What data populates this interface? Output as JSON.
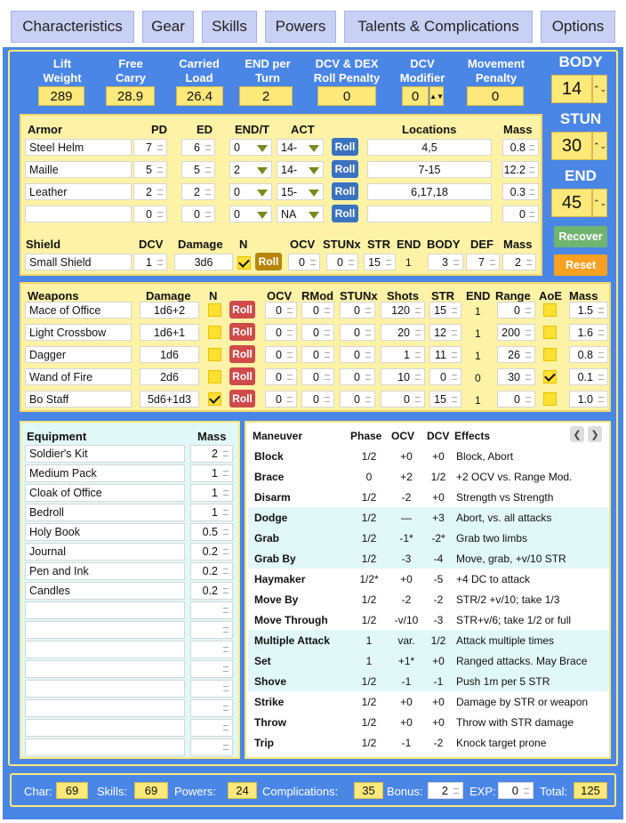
{
  "tabs": [
    "Characteristics",
    "Gear",
    "Skills",
    "Powers",
    "Talents & Complications",
    "Options"
  ],
  "stats": [
    {
      "label": "Lift Weight",
      "value": "289"
    },
    {
      "label": "Free Carry",
      "value": "28.9"
    },
    {
      "label": "Carried Load",
      "value": "26.4"
    },
    {
      "label": "END per Turn",
      "value": "2"
    },
    {
      "label": "DCV & DEX Roll Penalty",
      "value": "0"
    },
    {
      "label": "DCV Modifier",
      "value": "0"
    },
    {
      "label": "Movement Penalty",
      "value": "0"
    }
  ],
  "side": {
    "body_label": "BODY",
    "body": "14",
    "stun_label": "STUN",
    "stun": "30",
    "end_label": "END",
    "end": "45",
    "recover": "Recover",
    "reset": "Reset"
  },
  "armor": {
    "headers": [
      "Armor",
      "PD",
      "ED",
      "END/T",
      "ACT",
      "Locations",
      "Mass"
    ],
    "roll": "Roll",
    "rows": [
      {
        "name": "Steel Helm",
        "pd": "7",
        "ed": "6",
        "end": "0",
        "act": "14-",
        "loc": "4,5",
        "mass": "0.8"
      },
      {
        "name": "Maille",
        "pd": "5",
        "ed": "5",
        "end": "2",
        "act": "14-",
        "loc": "7-15",
        "mass": "12.2"
      },
      {
        "name": "Leather",
        "pd": "2",
        "ed": "2",
        "end": "0",
        "act": "15-",
        "loc": "6,17,18",
        "mass": "0.3"
      },
      {
        "name": "",
        "pd": "0",
        "ed": "0",
        "end": "0",
        "act": "NA",
        "loc": "",
        "mass": "0"
      }
    ]
  },
  "shield": {
    "headers": [
      "Shield",
      "DCV",
      "Damage",
      "N",
      "OCV",
      "STUNx",
      "STR",
      "END",
      "BODY",
      "DEF",
      "Mass"
    ],
    "name": "Small Shield",
    "dcv": "1",
    "damage": "3d6",
    "ocv": "0",
    "stunx": "0",
    "str": "15",
    "end": "1",
    "body": "3",
    "def": "7",
    "mass": "2",
    "roll": "Roll"
  },
  "weapons": {
    "headers": [
      "Weapons",
      "Damage",
      "N",
      "OCV",
      "RMod",
      "STUNx",
      "Shots",
      "STR",
      "END",
      "Range",
      "AoE",
      "Mass"
    ],
    "roll": "Roll",
    "rows": [
      {
        "name": "Mace of Office",
        "damage": "1d6+2",
        "n": false,
        "ocv": "0",
        "rmod": "0",
        "stunx": "0",
        "shots": "120",
        "str": "15",
        "end": "1",
        "range": "0",
        "aoe": false,
        "mass": "1.5"
      },
      {
        "name": "Light Crossbow",
        "damage": "1d6+1",
        "n": false,
        "ocv": "0",
        "rmod": "0",
        "stunx": "0",
        "shots": "20",
        "str": "12",
        "end": "1",
        "range": "200",
        "aoe": false,
        "mass": "1.6"
      },
      {
        "name": "Dagger",
        "damage": "1d6",
        "n": false,
        "ocv": "0",
        "rmod": "0",
        "stunx": "0",
        "shots": "1",
        "str": "11",
        "end": "1",
        "range": "26",
        "aoe": false,
        "mass": "0.8"
      },
      {
        "name": "Wand of Fire",
        "damage": "2d6",
        "n": false,
        "ocv": "0",
        "rmod": "0",
        "stunx": "0",
        "shots": "10",
        "str": "0",
        "end": "0",
        "range": "30",
        "aoe": true,
        "mass": "0.1"
      },
      {
        "name": "Bo Staff",
        "damage": "5d6+1d3",
        "n": true,
        "ocv": "0",
        "rmod": "0",
        "stunx": "0",
        "shots": "0",
        "str": "15",
        "end": "1",
        "range": "0",
        "aoe": false,
        "mass": "1.0"
      }
    ]
  },
  "equipment": {
    "headers": [
      "Equipment",
      "Mass"
    ],
    "rows": [
      {
        "name": "Soldier's Kit",
        "mass": "2"
      },
      {
        "name": "Medium Pack",
        "mass": "1"
      },
      {
        "name": "Cloak of Office",
        "mass": "1"
      },
      {
        "name": "Bedroll",
        "mass": "1"
      },
      {
        "name": "Holy Book",
        "mass": "0.5"
      },
      {
        "name": "Journal",
        "mass": "0.2"
      },
      {
        "name": "Pen and Ink",
        "mass": "0.2"
      },
      {
        "name": "Candles",
        "mass": "0.2"
      },
      {
        "name": "",
        "mass": ""
      },
      {
        "name": "",
        "mass": ""
      },
      {
        "name": "",
        "mass": ""
      },
      {
        "name": "",
        "mass": ""
      },
      {
        "name": "",
        "mass": ""
      },
      {
        "name": "",
        "mass": ""
      },
      {
        "name": "",
        "mass": ""
      },
      {
        "name": "",
        "mass": ""
      }
    ]
  },
  "maneuvers": {
    "headers": [
      "Maneuver",
      "Phase",
      "OCV",
      "DCV",
      "Effects"
    ],
    "rows": [
      {
        "name": "Block",
        "phase": "1/2",
        "ocv": "+0",
        "dcv": "+0",
        "eff": "Block, Abort",
        "hl": false
      },
      {
        "name": "Brace",
        "phase": "0",
        "ocv": "+2",
        "dcv": "1/2",
        "eff": "+2 OCV vs. Range Mod.",
        "hl": false
      },
      {
        "name": "Disarm",
        "phase": "1/2",
        "ocv": "-2",
        "dcv": "+0",
        "eff": "Strength vs Strength",
        "hl": false
      },
      {
        "name": "Dodge",
        "phase": "1/2",
        "ocv": "—",
        "dcv": "+3",
        "eff": "Abort, vs. all attacks",
        "hl": true
      },
      {
        "name": "Grab",
        "phase": "1/2",
        "ocv": "-1*",
        "dcv": "-2*",
        "eff": "Grab two limbs",
        "hl": true
      },
      {
        "name": "Grab By",
        "phase": "1/2",
        "ocv": "-3",
        "dcv": "-4",
        "eff": "Move, grab, +v/10 STR",
        "hl": true
      },
      {
        "name": "Haymaker",
        "phase": "1/2*",
        "ocv": "+0",
        "dcv": "-5",
        "eff": "+4 DC to attack",
        "hl": false
      },
      {
        "name": "Move By",
        "phase": "1/2",
        "ocv": "-2",
        "dcv": "-2",
        "eff": "STR/2 +v/10; take 1/3",
        "hl": false
      },
      {
        "name": "Move Through",
        "phase": "1/2",
        "ocv": "-v/10",
        "dcv": "-3",
        "eff": "STR+v/6; take 1/2 or full",
        "hl": false
      },
      {
        "name": "Multiple Attack",
        "phase": "1",
        "ocv": "var.",
        "dcv": "1/2",
        "eff": "Attack multiple times",
        "hl": true
      },
      {
        "name": "Set",
        "phase": "1",
        "ocv": "+1*",
        "dcv": "+0",
        "eff": "Ranged attacks. May Brace",
        "hl": true
      },
      {
        "name": "Shove",
        "phase": "1/2",
        "ocv": "-1",
        "dcv": "-1",
        "eff": "Push 1m per 5 STR",
        "hl": true
      },
      {
        "name": "Strike",
        "phase": "1/2",
        "ocv": "+0",
        "dcv": "+0",
        "eff": "Damage by STR or weapon",
        "hl": false
      },
      {
        "name": "Throw",
        "phase": "1/2",
        "ocv": "+0",
        "dcv": "+0",
        "eff": "Throw with STR damage",
        "hl": false
      },
      {
        "name": "Trip",
        "phase": "1/2",
        "ocv": "-1",
        "dcv": "-2",
        "eff": "Knock target prone",
        "hl": false
      }
    ]
  },
  "footer": {
    "char_label": "Char:",
    "char": "69",
    "skills_label": "Skills:",
    "skills": "69",
    "powers_label": "Powers:",
    "powers": "24",
    "comp_label": "Complications:",
    "comp": "35",
    "bonus_label": "Bonus:",
    "bonus": "2",
    "exp_label": "EXP:",
    "exp": "0",
    "total_label": "Total:",
    "total": "125"
  }
}
